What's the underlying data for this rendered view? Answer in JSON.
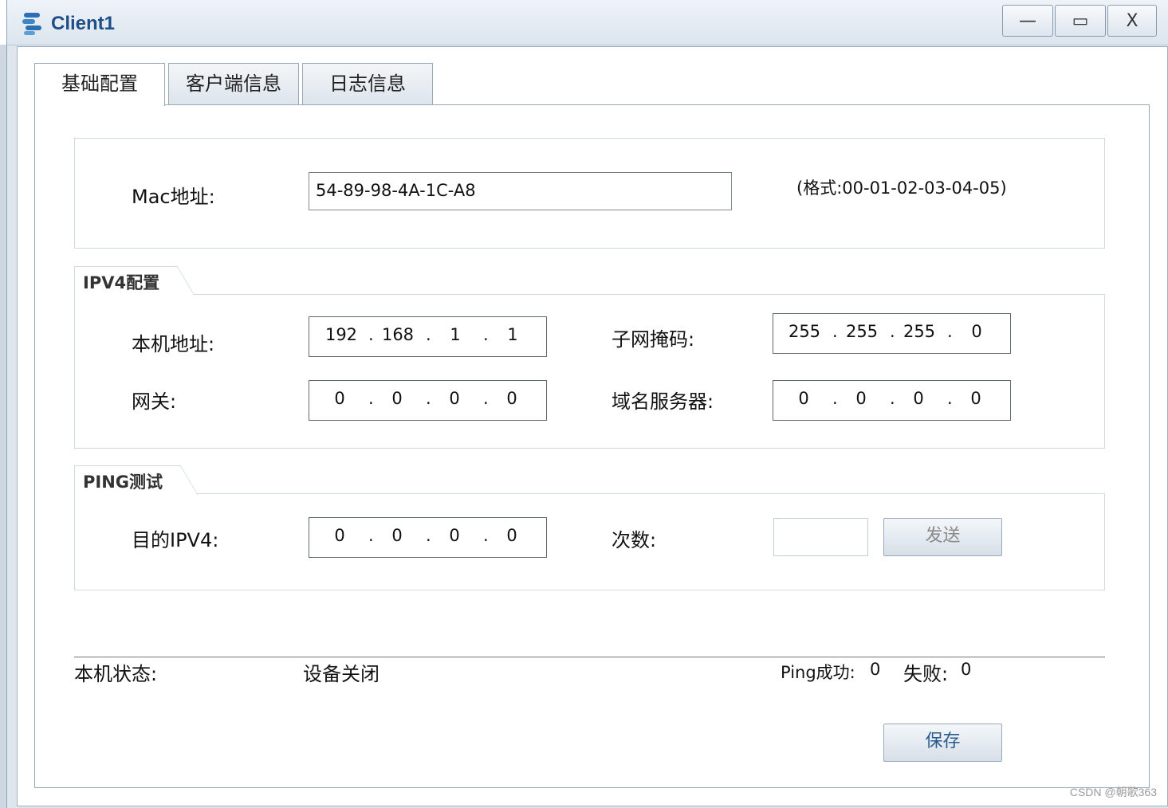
{
  "window": {
    "title": "Client1",
    "min": "—",
    "max": "▭",
    "close": "X"
  },
  "tabs": [
    "基础配置",
    "客户端信息",
    "日志信息"
  ],
  "mac": {
    "label": "Mac地址:",
    "value": "54-89-98-4A-1C-A8",
    "hint": "(格式:00-01-02-03-04-05)"
  },
  "ipv4": {
    "section": "IPV4配置",
    "host_label": "本机地址:",
    "host": [
      "192",
      "168",
      "1",
      "1"
    ],
    "mask_label": "子网掩码:",
    "mask": [
      "255",
      "255",
      "255",
      "0"
    ],
    "gateway_label": "网关:",
    "gateway": [
      "0",
      "0",
      "0",
      "0"
    ],
    "dns_label": "域名服务器:",
    "dns": [
      "0",
      "0",
      "0",
      "0"
    ]
  },
  "ping": {
    "section": "PING测试",
    "dest_label": "目的IPV4:",
    "dest": [
      "0",
      "0",
      "0",
      "0"
    ],
    "count_label": "次数:",
    "count_value": "",
    "send": "发送"
  },
  "status": {
    "label": "本机状态:",
    "value": "设备关闭",
    "ping_success_label": "Ping成功:",
    "ping_success": "0",
    "fail_label": "失败:",
    "fail": "0"
  },
  "save": "保存",
  "watermark": "CSDN @朝歌363"
}
